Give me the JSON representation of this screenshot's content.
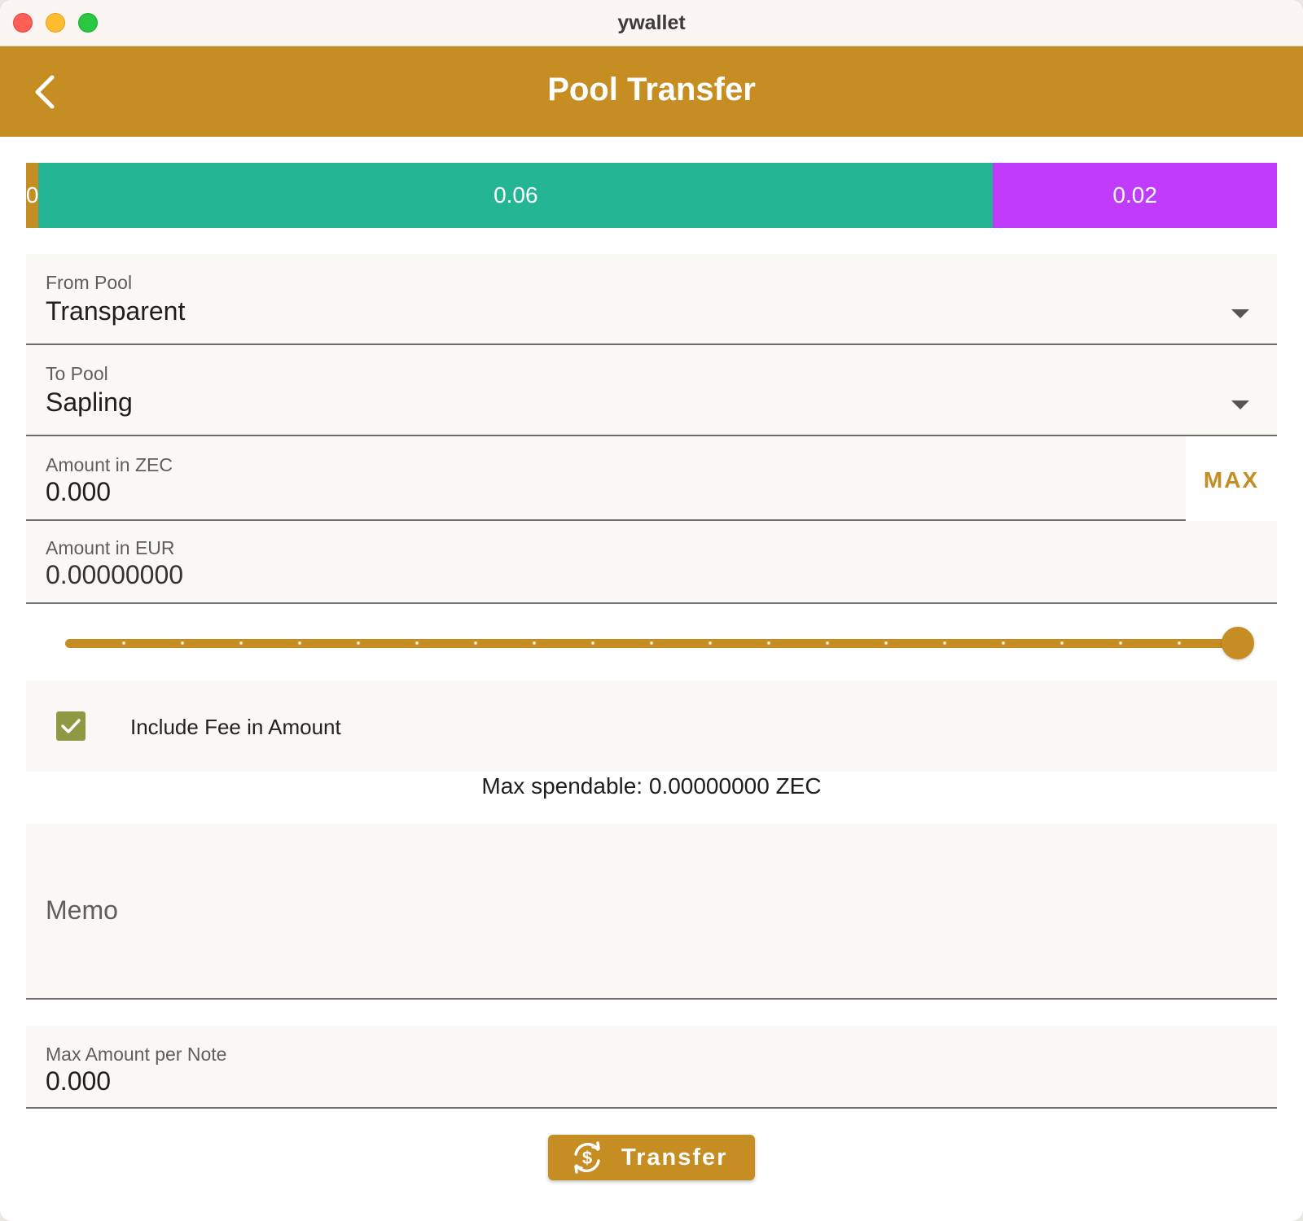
{
  "window": {
    "title": "ywallet"
  },
  "appbar": {
    "title": "Pool Transfer",
    "back_icon": "chevron-left-icon"
  },
  "pool_balances": [
    {
      "label": "0",
      "share": 0.01,
      "color": "#c68d22"
    },
    {
      "label": "0.06",
      "share": 0.763,
      "color": "#24b594"
    },
    {
      "label": "0.02",
      "share": 0.227,
      "color": "#c03bfc"
    }
  ],
  "from_pool": {
    "label": "From Pool",
    "value": "Transparent"
  },
  "to_pool": {
    "label": "To Pool",
    "value": "Sapling"
  },
  "amount_zec": {
    "label": "Amount in ZEC",
    "value": "0.000",
    "max_label": "MAX"
  },
  "amount_eur": {
    "label": "Amount in EUR",
    "value": "0.00000000"
  },
  "slider": {
    "value_fraction": 1.0,
    "ticks": 20
  },
  "include_fee": {
    "label": "Include Fee in Amount",
    "checked": true
  },
  "max_spendable": "Max spendable: 0.00000000 ZEC",
  "memo": {
    "placeholder": "Memo"
  },
  "max_per_note": {
    "label": "Max Amount per Note",
    "value": "0.000"
  },
  "transfer_button": {
    "label": "Transfer",
    "icon": "currency-exchange-icon"
  },
  "colors": {
    "accent": "#c68d22",
    "checkbox": "#8e9a43",
    "field_bg": "#faf8f5"
  }
}
